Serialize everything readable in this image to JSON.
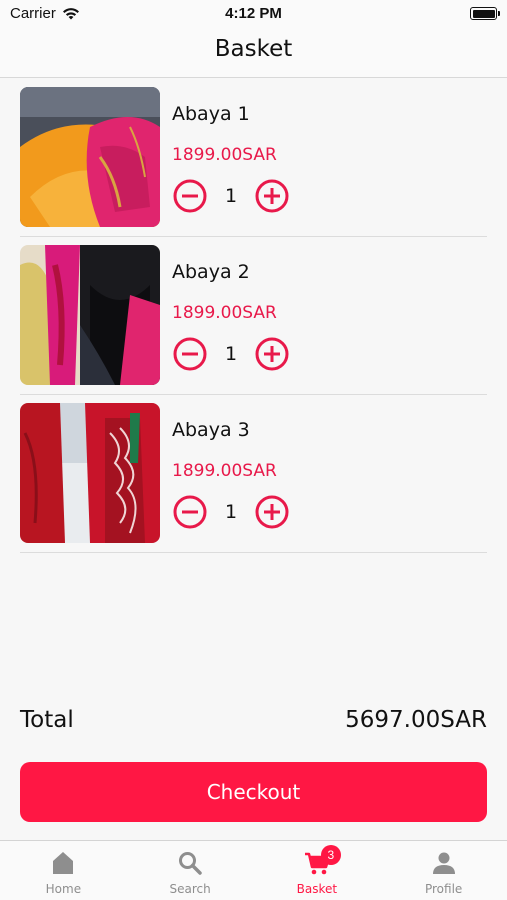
{
  "status_bar": {
    "carrier": "Carrier",
    "time": "4:12 PM"
  },
  "header": {
    "title": "Basket"
  },
  "items": [
    {
      "name": "Abaya 1",
      "price": "1899.00SAR",
      "quantity": "1"
    },
    {
      "name": "Abaya 2",
      "price": "1899.00SAR",
      "quantity": "1"
    },
    {
      "name": "Abaya 3",
      "price": "1899.00SAR",
      "quantity": "1"
    }
  ],
  "summary": {
    "total_label": "Total",
    "total_value": "5697.00SAR"
  },
  "checkout": {
    "label": "Checkout"
  },
  "tab_bar": {
    "tabs": [
      {
        "label": "Home",
        "icon": "home-icon"
      },
      {
        "label": "Search",
        "icon": "search-icon"
      },
      {
        "label": "Basket",
        "icon": "cart-icon",
        "badge": "3"
      },
      {
        "label": "Profile",
        "icon": "profile-icon"
      }
    ],
    "active": "Basket"
  },
  "colors": {
    "accent": "#ff1744",
    "price": "#e8194a",
    "inactive_tab": "#8e8e8e"
  }
}
